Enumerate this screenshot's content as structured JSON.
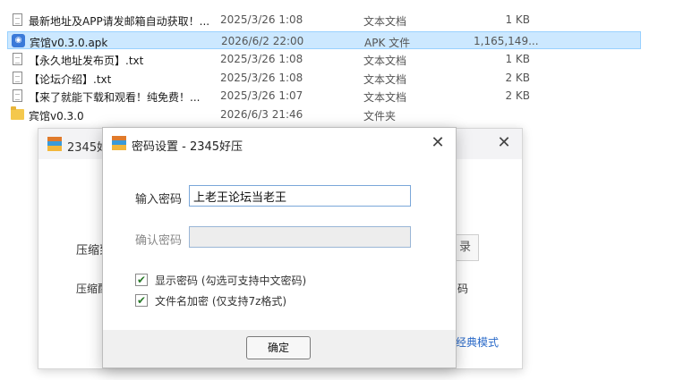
{
  "files": [
    {
      "name": "最新地址及APP请发邮箱自动获取！...",
      "date": "2025/3/26 1:08",
      "type": "文本文档",
      "size": "1 KB",
      "icon": "text-document-icon",
      "selected": false
    },
    {
      "name": "宾馆v0.3.0.apk",
      "date": "2026/6/2 22:00",
      "type": "APK 文件",
      "size": "1,165,149...",
      "icon": "apk-file-icon",
      "selected": true
    },
    {
      "name": "【永久地址发布页】.txt",
      "date": "2025/3/26 1:08",
      "type": "文本文档",
      "size": "1 KB",
      "icon": "text-document-icon",
      "selected": false
    },
    {
      "name": "【论坛介绍】.txt",
      "date": "2025/3/26 1:08",
      "type": "文本文档",
      "size": "2 KB",
      "icon": "text-document-icon",
      "selected": false
    },
    {
      "name": "【来了就能下载和观看！纯免费！...",
      "date": "2025/3/26 1:07",
      "type": "文本文档",
      "size": "2 KB",
      "icon": "text-document-icon",
      "selected": false
    },
    {
      "name": "宾馆v0.3.0",
      "date": "2026/6/3 21:46",
      "type": "文件夹",
      "size": "",
      "icon": "folder-icon",
      "selected": false
    }
  ],
  "bg_window": {
    "title": "2345好",
    "close": "✕",
    "label1": "压缩到",
    "label2": "压缩配",
    "button_partial": "录",
    "right_text": "码",
    "link": "经典模式"
  },
  "dialog": {
    "title": "密码设置 - 2345好压",
    "close": "✕",
    "password_label": "输入密码",
    "password_value": "上老王论坛当老王",
    "confirm_label": "确认密码",
    "confirm_value": "",
    "show_password_label": "显示密码 (勾选可支持中文密码)",
    "show_password_checked": true,
    "encrypt_filenames_label": "文件名加密  (仅支持7z格式)",
    "encrypt_filenames_checked": true,
    "ok_label": "确定"
  },
  "colors": {
    "selection": "#cce8ff",
    "accent": "#2a6ac9",
    "input_border": "#7aa7d9"
  }
}
